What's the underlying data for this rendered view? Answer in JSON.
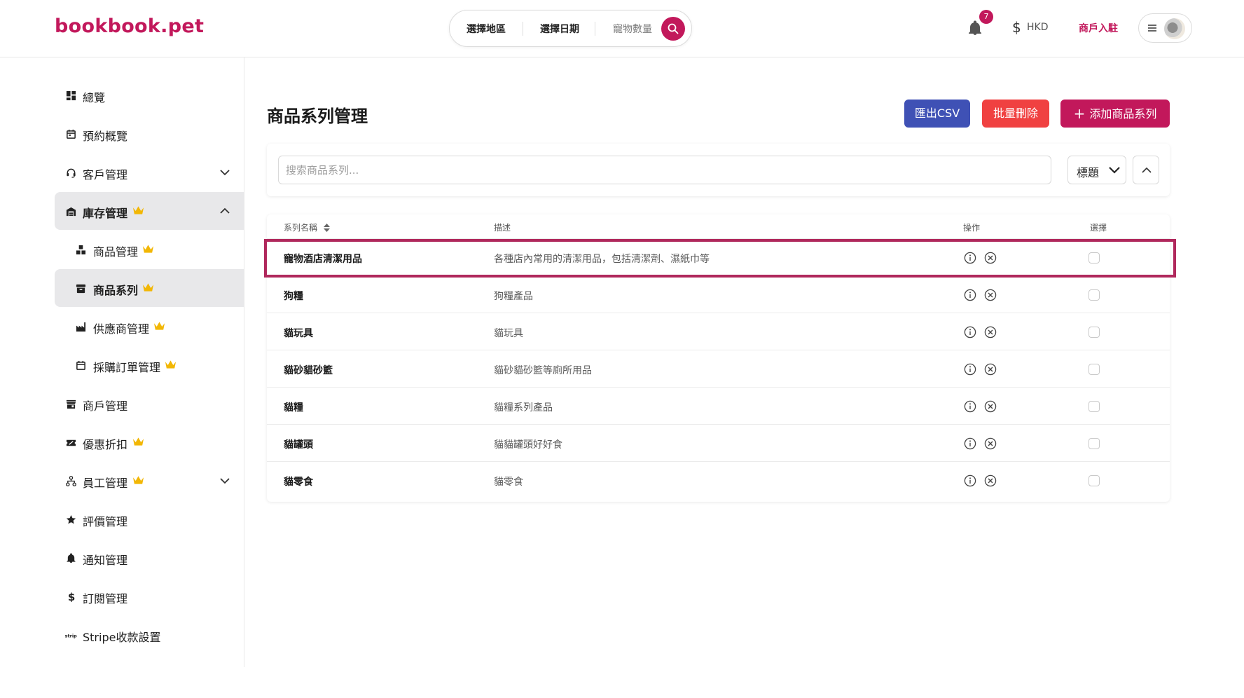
{
  "header": {
    "logo": "bookbook.pet",
    "search": {
      "region_label": "選擇地區",
      "date_label": "選擇日期",
      "pets_label": "寵物數量"
    },
    "notification_count": "7",
    "currency": "HKD",
    "merchant_link": "商戶入駐"
  },
  "sidebar": {
    "items": [
      {
        "label": "總覽",
        "icon": "dashboard-icon"
      },
      {
        "label": "預約概覽",
        "icon": "calendar-icon"
      },
      {
        "label": "客戶管理",
        "icon": "headset-icon",
        "expandable": true
      },
      {
        "label": "庫存管理",
        "icon": "warehouse-icon",
        "premium": true,
        "expanded": true
      },
      {
        "label": "商品管理",
        "icon": "boxes-icon",
        "premium": true
      },
      {
        "label": "商品系列",
        "icon": "archive-icon",
        "premium": true,
        "active": true
      },
      {
        "label": "供應商管理",
        "icon": "factory-icon",
        "premium": true
      },
      {
        "label": "採購訂單管理",
        "icon": "calendar-icon",
        "premium": true
      },
      {
        "label": "商戶管理",
        "icon": "store-icon"
      },
      {
        "label": "優惠折扣",
        "icon": "ticket-icon",
        "premium": true
      },
      {
        "label": "員工管理",
        "icon": "org-chart-icon",
        "premium": true,
        "expandable": true
      },
      {
        "label": "評價管理",
        "icon": "star-icon"
      },
      {
        "label": "通知管理",
        "icon": "bell-icon"
      },
      {
        "label": "訂閱管理",
        "icon": "dollar-icon"
      },
      {
        "label": "Stripe收款設置",
        "icon": "stripe-icon"
      }
    ]
  },
  "main": {
    "title": "商品系列管理",
    "buttons": {
      "export": "匯出CSV",
      "bulk_delete": "批量刪除",
      "add": "添加商品系列",
      "add_symbol": "+"
    },
    "filter": {
      "placeholder": "搜索商品系列...",
      "sort_field": "標題"
    },
    "table": {
      "headers": {
        "name": "系列名稱",
        "description": "描述",
        "actions": "操作",
        "select": "選擇"
      },
      "rows": [
        {
          "name": "寵物酒店清潔用品",
          "description": "各種店內常用的清潔用品，包括清潔劑、濕紙巾等",
          "highlighted": true
        },
        {
          "name": "狗糧",
          "description": "狗糧產品"
        },
        {
          "name": "貓玩具",
          "description": "貓玩具"
        },
        {
          "name": "貓砂貓砂籃",
          "description": "貓砂貓砂籃等廁所用品"
        },
        {
          "name": "貓糧",
          "description": "貓糧系列產品"
        },
        {
          "name": "貓罐頭",
          "description": "貓貓罐頭好好食"
        },
        {
          "name": "貓零食",
          "description": "貓零食"
        }
      ]
    }
  },
  "colors": {
    "brand": "#c2185b",
    "export_button": "#3f51b5",
    "delete_button": "#f04141",
    "crown": "#f2b705",
    "highlight_border": "#b0285c"
  }
}
